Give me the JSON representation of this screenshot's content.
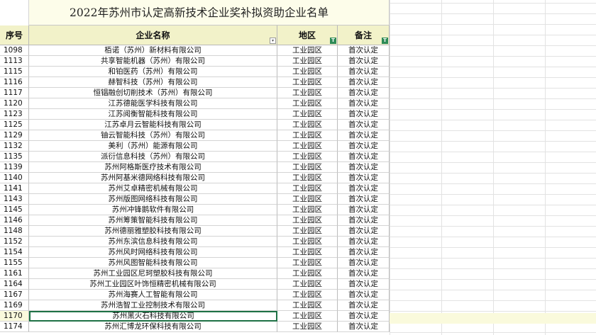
{
  "title": "2022年苏州市认定高新技术企业奖补拟资助企业名单",
  "headers": {
    "num": "序号",
    "name": "企业名称",
    "area": "地区",
    "note": "备注"
  },
  "filter_icon": "T",
  "dropdown_icon": "▾",
  "rows": [
    {
      "num": "1098",
      "name": "栢诺（苏州）新材料有限公司",
      "area": "工业园区",
      "note": "首次认定"
    },
    {
      "num": "1113",
      "name": "共享智能机器（苏州）有限公司",
      "area": "工业园区",
      "note": "首次认定"
    },
    {
      "num": "1115",
      "name": "和铂医药（苏州）有限公司",
      "area": "工业园区",
      "note": "首次认定"
    },
    {
      "num": "1116",
      "name": "赫智科技（苏州）有限公司",
      "area": "工业园区",
      "note": "首次认定"
    },
    {
      "num": "1117",
      "name": "恒锠融创切削技术（苏州）有限公司",
      "area": "工业园区",
      "note": "首次认定"
    },
    {
      "num": "1120",
      "name": "江苏德能医学科技有限公司",
      "area": "工业园区",
      "note": "首次认定"
    },
    {
      "num": "1123",
      "name": "江苏阅衡智能科技有限公司",
      "area": "工业园区",
      "note": "首次认定"
    },
    {
      "num": "1125",
      "name": "江苏卓月云智能科技有限公司",
      "area": "工业园区",
      "note": "首次认定"
    },
    {
      "num": "1129",
      "name": "铀云智能科技（苏州）有限公司",
      "area": "工业园区",
      "note": "首次认定"
    },
    {
      "num": "1132",
      "name": "美利（苏州）能源有限公司",
      "area": "工业园区",
      "note": "首次认定"
    },
    {
      "num": "1135",
      "name": "派衍信息科技（苏州）有限公司",
      "area": "工业园区",
      "note": "首次认定"
    },
    {
      "num": "1139",
      "name": "苏州阿格斯医疗技术有限公司",
      "area": "工业园区",
      "note": "首次认定"
    },
    {
      "num": "1140",
      "name": "苏州阿基米德网络科技有限公司",
      "area": "工业园区",
      "note": "首次认定"
    },
    {
      "num": "1141",
      "name": "苏州艾卓精密机械有限公司",
      "area": "工业园区",
      "note": "首次认定"
    },
    {
      "num": "1143",
      "name": "苏州版图网络科技有限公司",
      "area": "工业园区",
      "note": "首次认定"
    },
    {
      "num": "1145",
      "name": "苏州冲锋鹅软件有限公司",
      "area": "工业园区",
      "note": "首次认定"
    },
    {
      "num": "1146",
      "name": "苏州筹策智能科技有限公司",
      "area": "工业园区",
      "note": "首次认定"
    },
    {
      "num": "1148",
      "name": "苏州德丽雅塑胶科技有限公司",
      "area": "工业园区",
      "note": "首次认定"
    },
    {
      "num": "1152",
      "name": "苏州东滨信息科技有限公司",
      "area": "工业园区",
      "note": "首次认定"
    },
    {
      "num": "1154",
      "name": "苏州风时网络科技有限公司",
      "area": "工业园区",
      "note": "首次认定"
    },
    {
      "num": "1155",
      "name": "苏州风图智能科技有限公司",
      "area": "工业园区",
      "note": "首次认定"
    },
    {
      "num": "1161",
      "name": "苏州工业园区尼珂塑胶科技有限公司",
      "area": "工业园区",
      "note": "首次认定"
    },
    {
      "num": "1164",
      "name": "苏州工业园区叶饰恒精密机械有限公司",
      "area": "工业园区",
      "note": "首次认定"
    },
    {
      "num": "1167",
      "name": "苏州海赛人工智能有限公司",
      "area": "工业园区",
      "note": "首次认定"
    },
    {
      "num": "1169",
      "name": "苏州浩智工业控制技术有限公司",
      "area": "工业园区",
      "note": "首次认定"
    },
    {
      "num": "1170",
      "name": "苏州黑火石科技有限公司",
      "area": "工业园区",
      "note": "首次认定",
      "selected": true
    },
    {
      "num": "1174",
      "name": "苏州汇博龙环保科技有限公司",
      "area": "工业园区",
      "note": "首次认定"
    }
  ]
}
